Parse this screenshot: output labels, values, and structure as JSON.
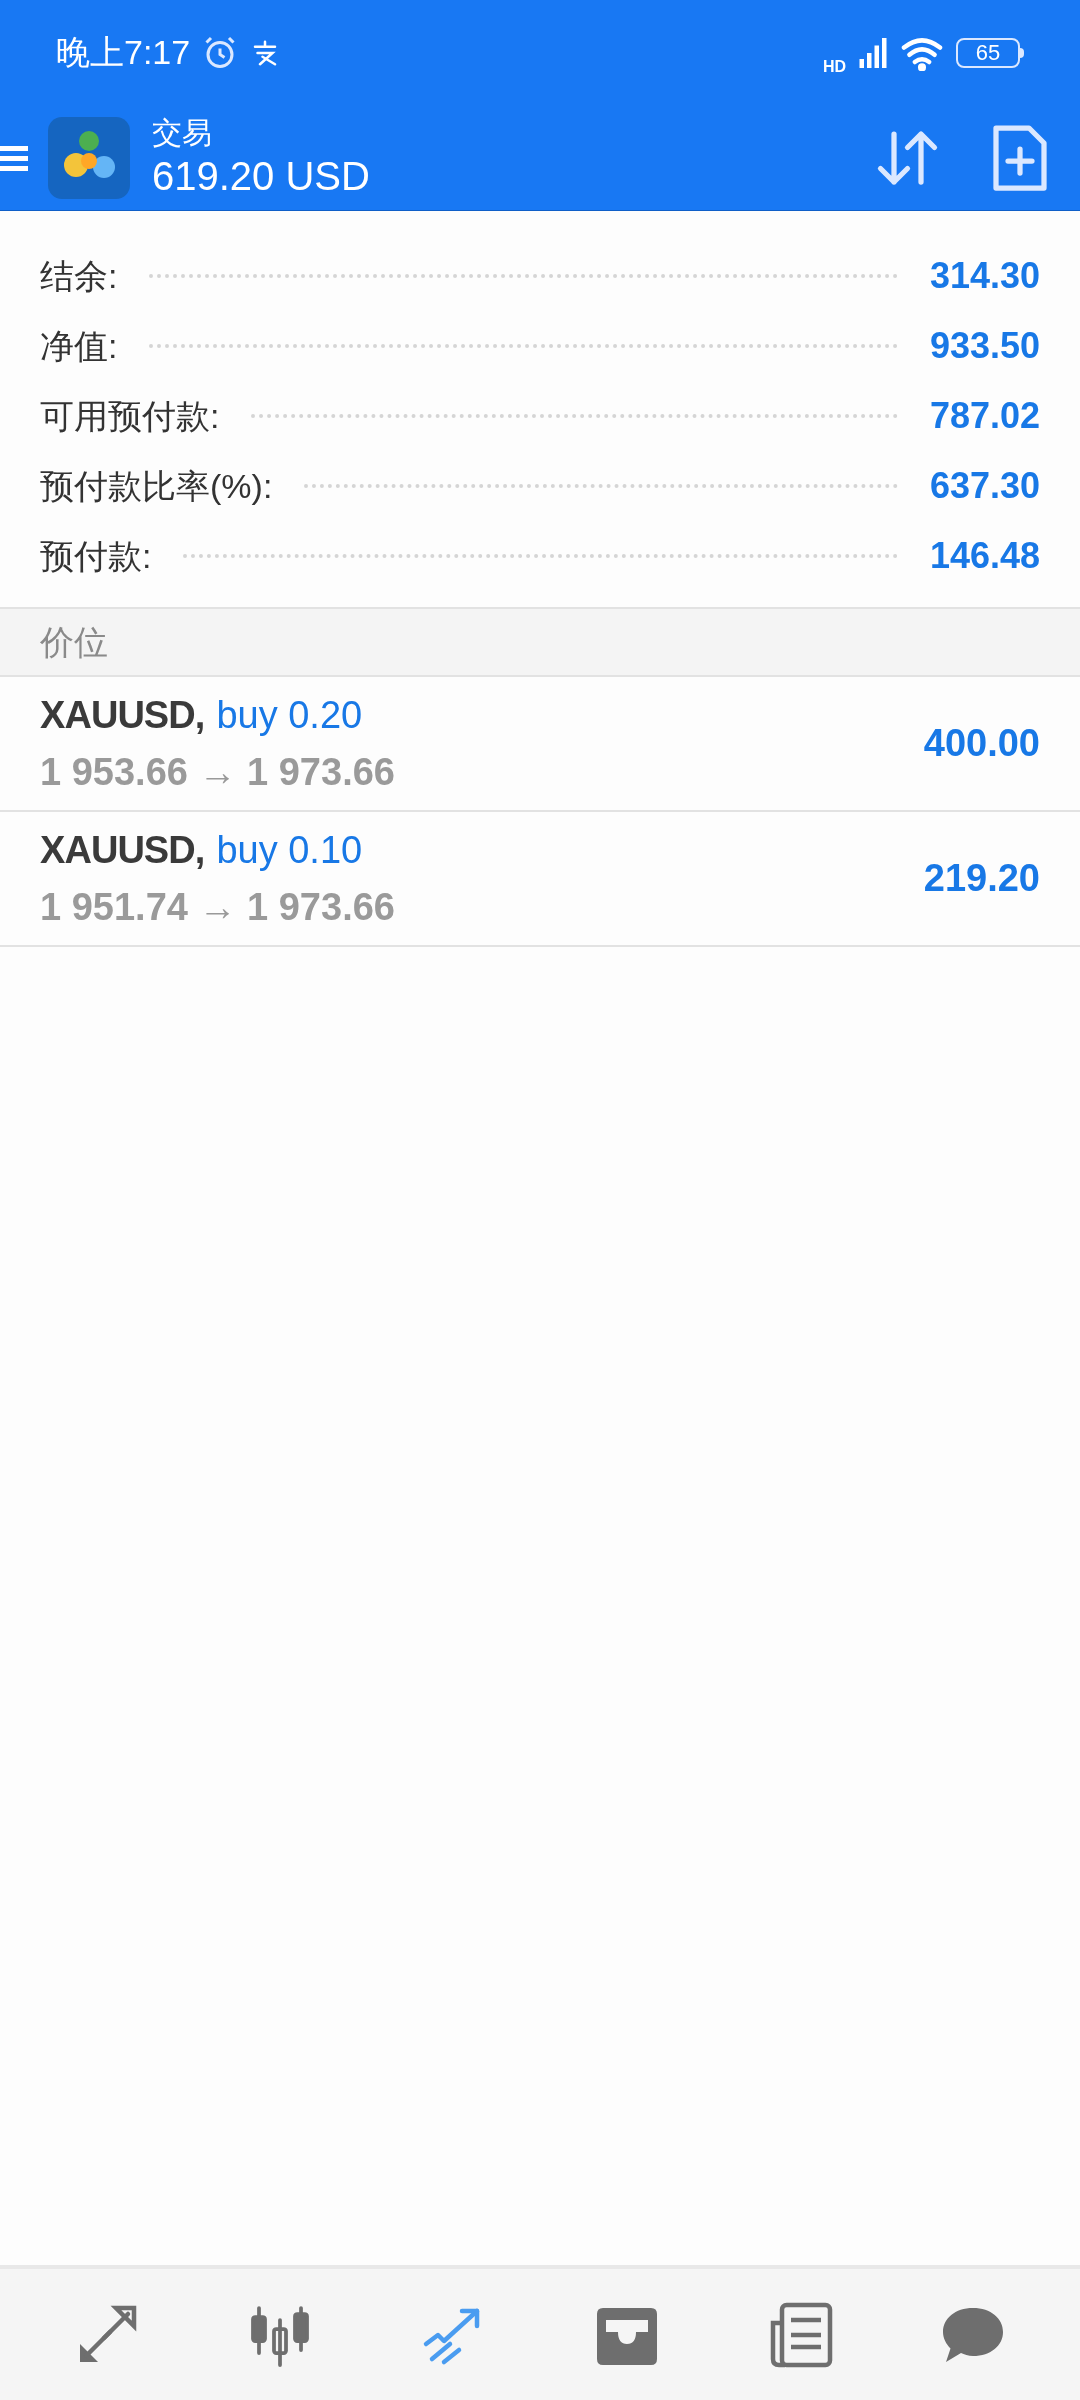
{
  "status_bar": {
    "time": "晚上7:17",
    "network": "HD",
    "battery": "65"
  },
  "header": {
    "title": "交易",
    "balance": "619.20 USD"
  },
  "summary": [
    {
      "label": "结余:",
      "value": "314.30"
    },
    {
      "label": "净值:",
      "value": "933.50"
    },
    {
      "label": "可用预付款:",
      "value": "787.02"
    },
    {
      "label": "预付款比率(%):",
      "value": "637.30"
    },
    {
      "label": "预付款:",
      "value": "146.48"
    }
  ],
  "section": {
    "title": "价位"
  },
  "positions": [
    {
      "symbol": "XAUUSD,",
      "order": "buy 0.20",
      "prices": "1 953.66 → 1 973.66",
      "profit": "400.00"
    },
    {
      "symbol": "XAUUSD,",
      "order": "buy 0.10",
      "prices": "1 951.74 → 1 973.66",
      "profit": "219.20"
    }
  ],
  "bottom_nav": [
    {
      "kind": "quotes",
      "selected": false
    },
    {
      "kind": "chart",
      "selected": false
    },
    {
      "kind": "trade",
      "selected": true
    },
    {
      "kind": "inbox",
      "selected": false
    },
    {
      "kind": "news",
      "selected": false
    },
    {
      "kind": "chat",
      "selected": false
    }
  ]
}
